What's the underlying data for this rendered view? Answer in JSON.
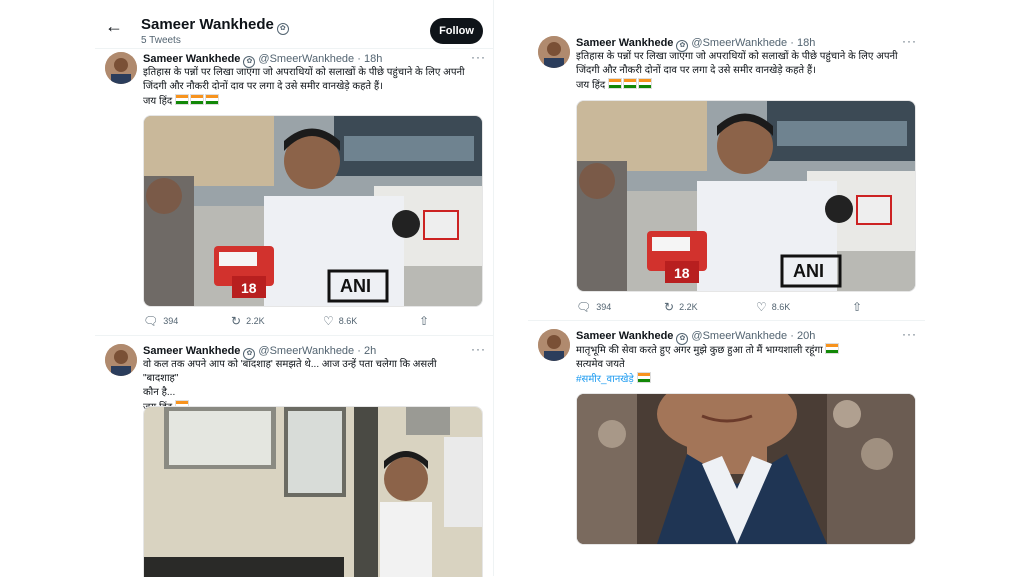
{
  "header": {
    "name": "Sameer Wankhede",
    "tweet_count": "5 Tweets",
    "follow_label": "Follow"
  },
  "tweets": [
    {
      "name": "Sameer Wankhede",
      "handle": "@SmeerWankhede",
      "time": "· 18h",
      "line1": "इतिहास के पन्नों पर लिखा जाएगा जो अपराधियों को सलाखों के पीछे पहुंचाने के लिए अपनी",
      "line2": "जिंदगी और नौकरी दोनों दाव पर लगा दे उसे समीर वानखेड़े कहते हैं।",
      "line3": "जय हिंद",
      "replies": "394",
      "retweets": "2.2K",
      "likes": "8.6K"
    },
    {
      "name": "Sameer Wankhede",
      "handle": "@SmeerWankhede",
      "time": "· 2h",
      "line1": "वो कल तक अपने आप को 'बादशाह' समझते थे... आज उन्हें पता चलेगा कि असली \"बादशाह\"",
      "line2": "कौन है...",
      "line3": "जय हिंद"
    },
    {
      "name": "Sameer Wankhede",
      "handle": "@SmeerWankhede",
      "time": "· 18h",
      "line1": "इतिहास के पन्नों पर लिखा जाएगा जो अपराधियों को सलाखों के पीछे पहुंचाने के लिए अपनी",
      "line2": "जिंदगी और नौकरी दोनों दाव पर लगा दे उसे समीर वानखेड़े कहते हैं।",
      "line3": "जय हिंद",
      "replies": "394",
      "retweets": "2.2K",
      "likes": "8.6K"
    },
    {
      "name": "Sameer Wankhede",
      "handle": "@SmeerWankhede",
      "time": "· 20h",
      "line1": "मातृभूमि की सेवा करते हुए अगर मुझे कुछ हुआ तो मैं भाग्यशाली रहूंगा",
      "line2": "सत्यमेव जयते",
      "hashtag": "#समीर_वानखेड़े"
    }
  ],
  "media_text": {
    "mic_label": "ANI",
    "mic_number": "18"
  },
  "icons": {
    "back": "arrow-left-icon",
    "verified": "verified-badge-icon",
    "more": "more-dots-icon",
    "reply": "reply-icon",
    "retweet": "retweet-icon",
    "like": "heart-icon",
    "share": "share-icon"
  },
  "colors": {
    "follow_bg": "#0f1419",
    "link": "#1d9bf0",
    "muted": "#536471"
  }
}
